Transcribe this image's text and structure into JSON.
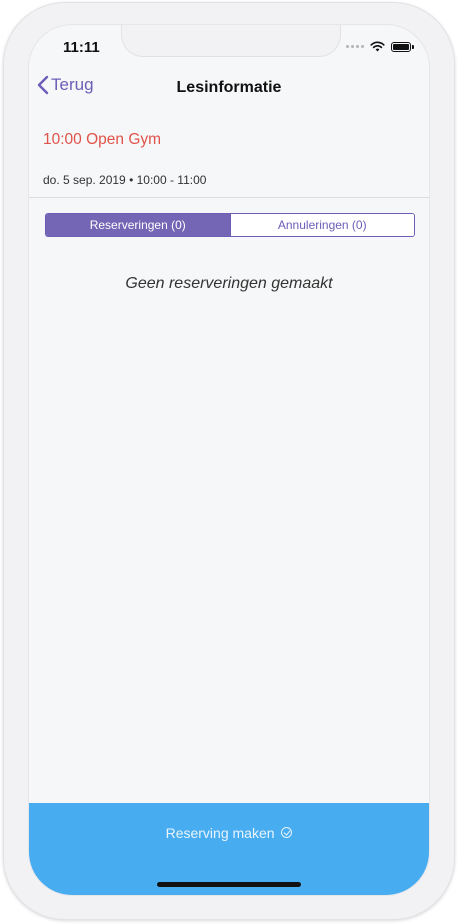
{
  "status_bar": {
    "time": "11:11",
    "icons": [
      "signal-dots-icon",
      "wifi-icon",
      "battery-icon"
    ]
  },
  "nav": {
    "back_label": "Terug",
    "title": "Lesinformatie"
  },
  "event": {
    "title": "10:00 Open Gym",
    "date": "do. 5 sep. 2019 • 10:00 - 11:00"
  },
  "tabs": [
    {
      "label": "Reserveringen (0)",
      "active": true
    },
    {
      "label": "Annuleringen (0)",
      "active": false
    }
  ],
  "empty_message": "Geen reserveringen gemaakt",
  "bottom_action": {
    "label": "Reserving maken",
    "icon": "check-circle-icon"
  },
  "colors": {
    "accent": "#6e5db8",
    "event_title": "#e0534a",
    "bottom_bar": "#48adf0"
  }
}
